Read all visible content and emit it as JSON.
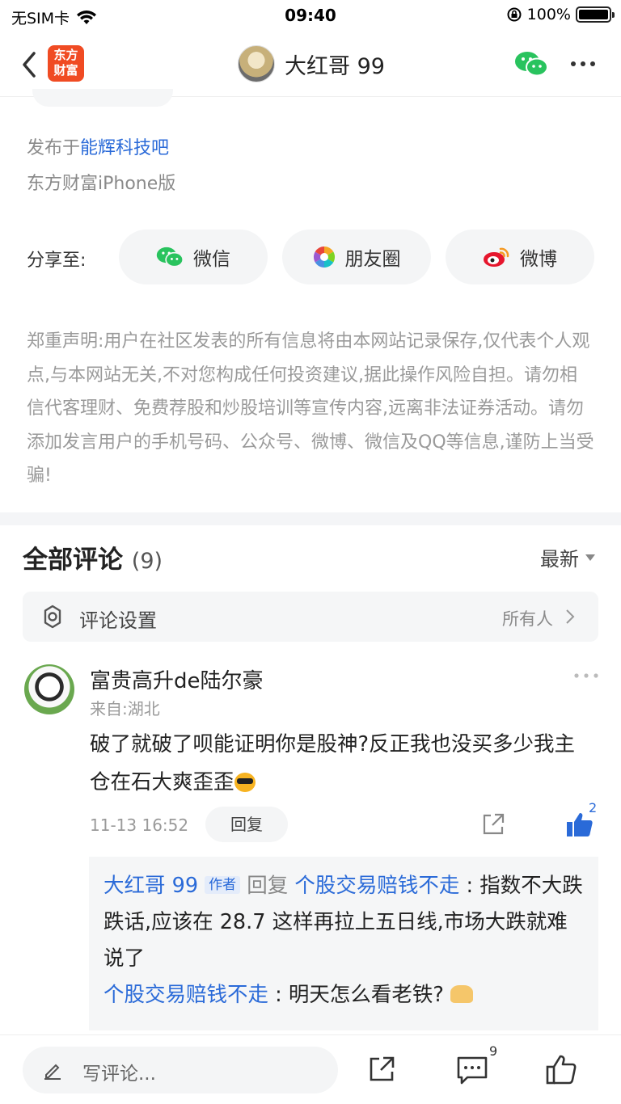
{
  "status_bar": {
    "carrier": "无SIM卡",
    "time": "09:40",
    "battery": "100%"
  },
  "nav": {
    "logo_line1": "东方",
    "logo_line2": "财富",
    "title": "大红哥 99"
  },
  "post_meta": {
    "posted_prefix": "发布于",
    "posted_forum": "能辉科技吧",
    "device": "东方财富iPhone版"
  },
  "share": {
    "label": "分享至:",
    "buttons": [
      {
        "label": "微信",
        "icon": "wechat-icon"
      },
      {
        "label": "朋友圈",
        "icon": "moments-icon"
      },
      {
        "label": "微博",
        "icon": "weibo-icon"
      }
    ]
  },
  "disclaimer": "郑重声明:用户在社区发表的所有信息将由本网站记录保存,仅代表个人观点,与本网站无关,不对您构成任何投资建议,据此操作风险自担。请勿相信代客理财、免费荐股和炒股培训等宣传内容,远离非法证券活动。请勿添加发言用户的手机号码、公众号、微博、微信及QQ等信息,谨防上当受骗!",
  "comments": {
    "title": "全部评论",
    "count": "(9)",
    "sort": "最新",
    "settings_label": "评论设置",
    "settings_value": "所有人"
  },
  "comment1": {
    "user": "富贵高升de陆尔豪",
    "from": "来自:湖北",
    "text": "破了就破了呗能证明你是股神?反正我也没买多少我主仓在石大爽歪歪",
    "time": "11-13 16:52",
    "reply_label": "回复",
    "likes": "2"
  },
  "replies": [
    {
      "author": "大红哥 99",
      "author_tag": "作者",
      "reply_word": "回复",
      "target": "个股交易赔钱不走",
      "sep": ":",
      "text": "指数不大跌跌话,应该在 28.7 这样再拉上五日线,市场大跌就难说了"
    },
    {
      "author": "个股交易赔钱不走",
      "sep": ":",
      "text": "明天怎么看老铁?"
    }
  ],
  "bottom_bar": {
    "placeholder": "写评论...",
    "comment_count": "9"
  }
}
